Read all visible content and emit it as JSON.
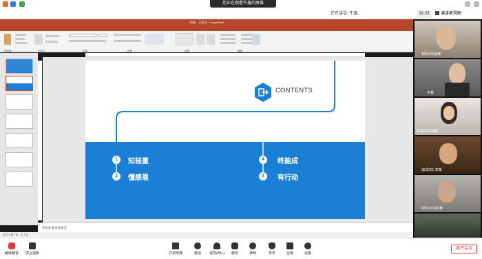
{
  "share_banner": "您正在观看牛鑫的屏幕",
  "speaking": {
    "prefix": "正在讲话:",
    "name": "牛鑫;"
  },
  "clock": "32:23",
  "view_button": "演讲者视图",
  "ppt": {
    "title": "文档1 - 已打开 - PowerPoint",
    "tabs": [
      "文件",
      "开始",
      "插入",
      "设计",
      "切换",
      "动画",
      "幻灯片放映",
      "审阅",
      "视图",
      "告诉我您想要做什么..."
    ],
    "ribbon_groups": [
      "剪贴板",
      "幻灯片",
      "字体",
      "段落",
      "绘图",
      "编辑"
    ],
    "notes_placeholder": "单击此处添加备注",
    "status": "幻灯片 第 2 张，共 7 张"
  },
  "slide": {
    "contents": "CONTENTS",
    "items": [
      {
        "num": "1",
        "text": "知轻重"
      },
      {
        "num": "2",
        "text": "懂感恩"
      },
      {
        "num": "4",
        "text": "终能成"
      },
      {
        "num": "3",
        "text": "有行动"
      }
    ]
  },
  "participants": [
    {
      "name": "材料202张某"
    },
    {
      "name": "牛鑫"
    },
    {
      "name": "环境2022刘某"
    },
    {
      "name": "海洋201 李某"
    },
    {
      "name": "材料2019孙某"
    }
  ],
  "bottombar": {
    "mute": "解除静音",
    "video": "停止视频",
    "share": "共享屏幕",
    "invite": "邀请",
    "members": "成员(99+)",
    "chat": "聊天",
    "record": "录制",
    "raise": "举手",
    "apps": "应用",
    "settings": "设置",
    "leave": "离开会议"
  },
  "colors": {
    "ppt_red": "#b7472a",
    "slide_blue": "#1b7fd6",
    "leave_red": "#e23b3b"
  }
}
